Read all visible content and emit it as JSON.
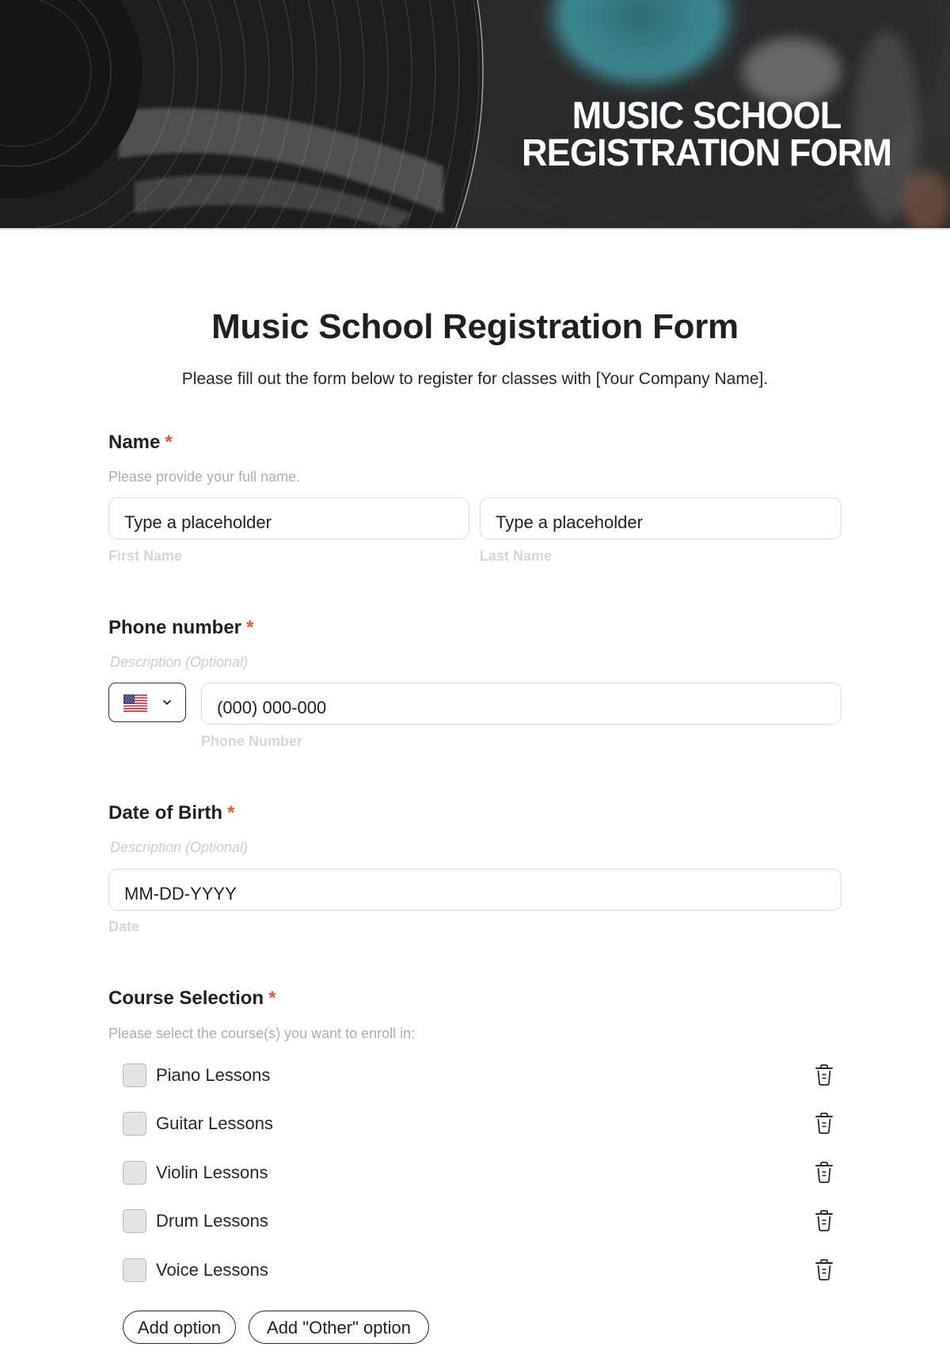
{
  "banner": {
    "title_line1": "MUSIC SCHOOL",
    "title_line2": "REGISTRATION FORM"
  },
  "form": {
    "title": "Music School Registration Form",
    "subtitle": "Please fill out the form below to register for classes with [Your Company Name]."
  },
  "fields": {
    "name": {
      "label": "Name",
      "required_mark": "*",
      "description": "Please provide your full name.",
      "first": {
        "value": "Type a placeholder",
        "sublabel": "First Name"
      },
      "last": {
        "value": "Type a placeholder",
        "sublabel": "Last Name"
      }
    },
    "phone": {
      "label": "Phone number",
      "required_mark": "*",
      "description": "Description (Optional)",
      "country": {
        "flag_icon": "us-flag-icon",
        "selected": "US"
      },
      "value": "(000) 000-000",
      "sublabel": "Phone Number"
    },
    "dob": {
      "label": "Date of Birth",
      "required_mark": "*",
      "description": "Description (Optional)",
      "value": "MM-DD-YYYY",
      "sublabel": "Date"
    },
    "courses": {
      "label": "Course Selection",
      "required_mark": "*",
      "description": "Please select the course(s) you want to enroll in:",
      "options": [
        {
          "label": "Piano Lessons",
          "checked": false
        },
        {
          "label": "Guitar Lessons",
          "checked": false
        },
        {
          "label": "Violin Lessons",
          "checked": false
        },
        {
          "label": "Drum Lessons",
          "checked": false
        },
        {
          "label": "Voice Lessons",
          "checked": false
        }
      ],
      "add_option_label": "Add option",
      "add_other_label": "Add \"Other\" option"
    }
  },
  "colors": {
    "required": "#f0522f",
    "text": "#1f2024",
    "muted": "#a9adb4",
    "border": "#d7dbe0",
    "banner_label_teal": "#3f8790"
  }
}
